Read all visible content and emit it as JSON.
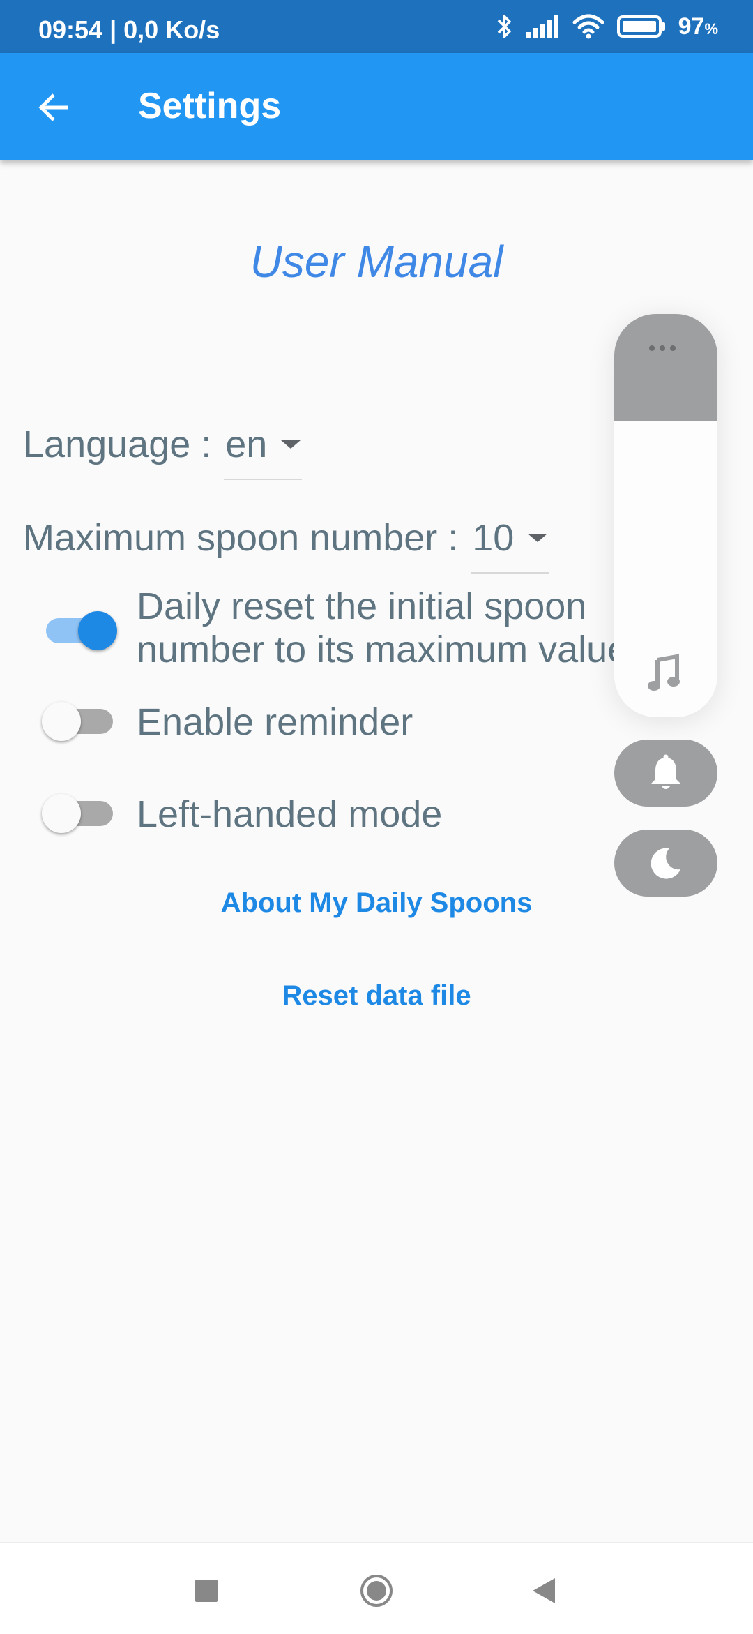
{
  "status_bar": {
    "time_speed": "09:54 | 0,0 Ko/s",
    "battery": "97",
    "battery_unit": "%",
    "icons": [
      "bluetooth-icon",
      "signal-icon",
      "wifi-icon",
      "battery-icon"
    ]
  },
  "app_bar": {
    "back_icon": "arrow-back-icon",
    "title": "Settings"
  },
  "content": {
    "user_manual": "User Manual",
    "language": {
      "label": "Language : ",
      "value": "en"
    },
    "max_spoon": {
      "label": "Maximum spoon number : ",
      "value": "10"
    },
    "daily_reset": {
      "line1": "Daily reset the initial spoon",
      "line2": "number to its maximum value",
      "enabled": true
    },
    "reminder": {
      "label": "Enable reminder",
      "enabled": false
    },
    "left_handed": {
      "label": "Left-handed mode",
      "enabled": false
    },
    "about_button": "About My Daily Spoons",
    "reset_button": "Reset data file"
  },
  "volume_panel": {
    "icons": [
      "more-dots-icon",
      "music-note-icon",
      "bell-icon",
      "moon-icon"
    ]
  },
  "nav_bar": {
    "icons": [
      "recents-square-icon",
      "home-circle-icon",
      "back-triangle-icon"
    ]
  },
  "colors": {
    "status_bar": "#1e71bd",
    "app_bar": "#2196f3",
    "accent": "#1e88e5",
    "text": "#5e7480"
  }
}
